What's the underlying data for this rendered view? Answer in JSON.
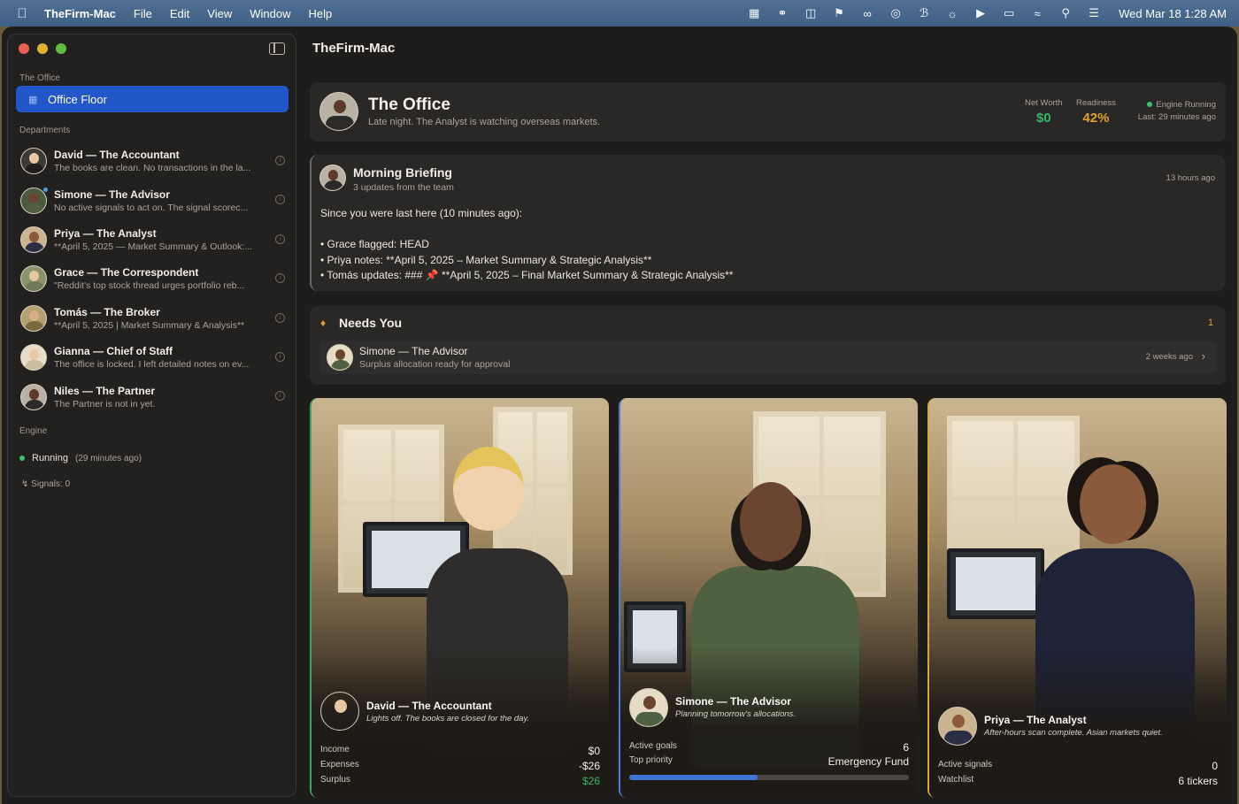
{
  "menubar": {
    "app_name": "TheFirm-Mac",
    "menus": [
      "File",
      "Edit",
      "View",
      "Window",
      "Help"
    ],
    "clock": "Wed Mar 18  1:28 AM",
    "status_icons": [
      "notes-icon",
      "creative-cloud-icon",
      "scanner-icon",
      "bug-icon",
      "glasses-icon",
      "airdrop-icon",
      "bluetooth-icon",
      "brightness-icon",
      "play-icon",
      "battery-icon",
      "wifi-icon",
      "search-icon",
      "control-center-icon"
    ]
  },
  "window": {
    "title": "TheFirm-Mac"
  },
  "sidebar": {
    "section_office": "The Office",
    "office_floor": "Office Floor",
    "section_departments": "Departments",
    "departments": [
      {
        "name": "David — The Accountant",
        "sub": "The books are clean. No transactions in the la...",
        "avatar_color": "#3b3a35",
        "skin": "#e9c9a3"
      },
      {
        "name": "Simone — The Advisor",
        "sub": "No active signals to act on. The signal scorec...",
        "avatar_color": "#4b5a3f",
        "skin": "#6b4530"
      },
      {
        "name": "Priya — The Analyst",
        "sub": "**April 5, 2025 — Market Summary & Outlook:...",
        "avatar_color": "#2a2f45",
        "skin": "#8a5a3c"
      },
      {
        "name": "Grace — The Correspondent",
        "sub": "\"Reddit's top stock thread urges portfolio reb...",
        "avatar_color": "#6e7a5a",
        "skin": "#e7c7a2"
      },
      {
        "name": "Tomás — The Broker",
        "sub": "**April 5, 2025 | Market Summary & Analysis**",
        "avatar_color": "#7a6a3e",
        "skin": "#d8ae85"
      },
      {
        "name": "Gianna — Chief of Staff",
        "sub": "The office is locked. I left detailed notes on ev...",
        "avatar_color": "#e8ddc9",
        "skin": "#e9c9a3"
      },
      {
        "name": "Niles — The Partner",
        "sub": "The Partner is not in yet.",
        "avatar_color": "#2c2a28",
        "skin": "#5b3a28"
      }
    ],
    "section_engine": "Engine",
    "engine_status": "Running",
    "engine_ago": "(29 minutes ago)",
    "signals": "Signals: 0"
  },
  "office_header": {
    "title": "The Office",
    "subtitle": "Late night. The Analyst is watching overseas markets.",
    "net_worth_label": "Net Worth",
    "net_worth_value": "$0",
    "readiness_label": "Readiness",
    "readiness_value": "42%",
    "engine_label": "Engine Running",
    "engine_last": "Last: 29 minutes ago"
  },
  "briefing": {
    "title": "Morning Briefing",
    "subtitle": "3 updates from the team",
    "time": "13 hours ago",
    "intro": "Since you were last here (10 minutes ago):",
    "lines": [
      "• Grace flagged: HEAD",
      "• Priya notes: **April 5, 2025 – Market Summary & Strategic Analysis**",
      "• Tomás updates: ### 📌 **April 5, 2025 – Final Market Summary & Strategic Analysis**"
    ]
  },
  "needs_you": {
    "title": "Needs You",
    "count": "1",
    "item_name": "Simone — The Advisor",
    "item_desc": "Surplus allocation ready for approval",
    "item_time": "2 weeks ago"
  },
  "cards": {
    "david": {
      "name": "David — The Accountant",
      "tagline": "Lights off. The books are closed for the day.",
      "income_label": "Income",
      "income_value": "$0",
      "expenses_label": "Expenses",
      "expenses_value": "-$26",
      "surplus_label": "Surplus",
      "surplus_value": "$26"
    },
    "simone": {
      "name": "Simone — The Advisor",
      "tagline": "Planning tomorrow's allocations.",
      "goals_label": "Active goals",
      "goals_value": "6",
      "priority_label": "Top priority",
      "priority_value": "Emergency Fund",
      "progress_fraction": 0.46
    },
    "priya": {
      "name": "Priya — The Analyst",
      "tagline": "After-hours scan complete. Asian markets quiet.",
      "signals_label": "Active signals",
      "signals_value": "0",
      "watchlist_label": "Watchlist",
      "watchlist_value": "6 tickers"
    }
  },
  "colors": {
    "accent_blue": "#2357c9",
    "green": "#38b36a",
    "amber": "#e0a12f"
  }
}
